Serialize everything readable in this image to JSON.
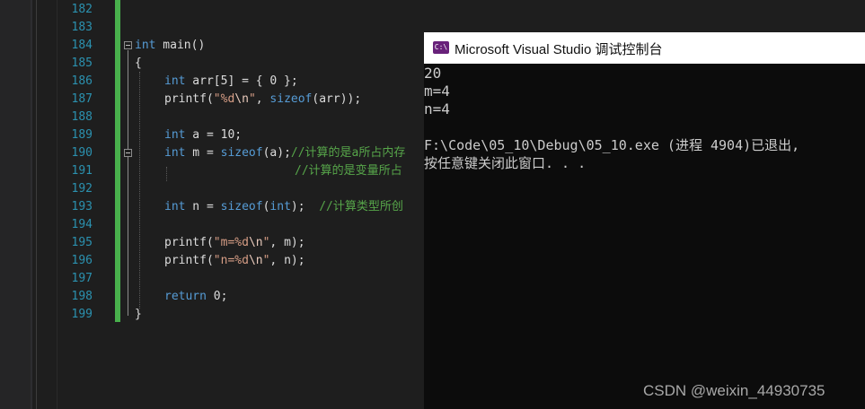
{
  "editor": {
    "line_numbers": [
      "182",
      "183",
      "184",
      "185",
      "186",
      "187",
      "188",
      "189",
      "190",
      "191",
      "192",
      "193",
      "194",
      "195",
      "196",
      "197",
      "198",
      "199"
    ],
    "lines": {
      "l184": {
        "kw": "int",
        "rest": " main()"
      },
      "l185": {
        "text": "{"
      },
      "l186": {
        "kw": "int",
        "rest": " arr[5] = { 0 };"
      },
      "l187": {
        "p1": "printf(",
        "s1": "\"%d",
        "e1": "\\n",
        "s2": "\"",
        "p2": ", ",
        "kw": "sizeof",
        "p3": "(arr));"
      },
      "l189": {
        "kw": "int",
        "rest": " a = 10;"
      },
      "l190": {
        "kw": "int",
        "p1": " m = ",
        "kw2": "sizeof",
        "p2": "(a);",
        "cmt": "//计算的是a所占内存"
      },
      "l191": {
        "cmt": "//计算的是变量所占"
      },
      "l193": {
        "kw": "int",
        "p1": " n = ",
        "kw2": "sizeof",
        "p2": "(",
        "kw3": "int",
        "p3": ");  ",
        "cmt": "//计算类型所创"
      },
      "l195": {
        "p1": "printf(",
        "s1": "\"m=%d",
        "e1": "\\n",
        "s2": "\"",
        "p2": ", m);"
      },
      "l196": {
        "p1": "printf(",
        "s1": "\"n=%d",
        "e1": "\\n",
        "s2": "\"",
        "p2": ", n);"
      },
      "l198": {
        "kw": "return",
        "rest": " 0;"
      },
      "l199": {
        "text": "}"
      }
    }
  },
  "console": {
    "title": "Microsoft Visual Studio 调试控制台",
    "icon_text": "C:\\",
    "output": [
      "20",
      "m=4",
      "n=4",
      "",
      "F:\\Code\\05_10\\Debug\\05_10.exe (进程 4904)已退出,",
      "按任意键关闭此窗口. . ."
    ]
  },
  "watermark": "CSDN @weixin_44930735",
  "colors": {
    "editor_bg": "#1e1e1e",
    "line_number": "#2b91af",
    "keyword": "#569cd6",
    "string": "#d69d85",
    "comment": "#57a64a",
    "change_bar": "#48b04c",
    "console_bg": "#0c0c0c"
  }
}
